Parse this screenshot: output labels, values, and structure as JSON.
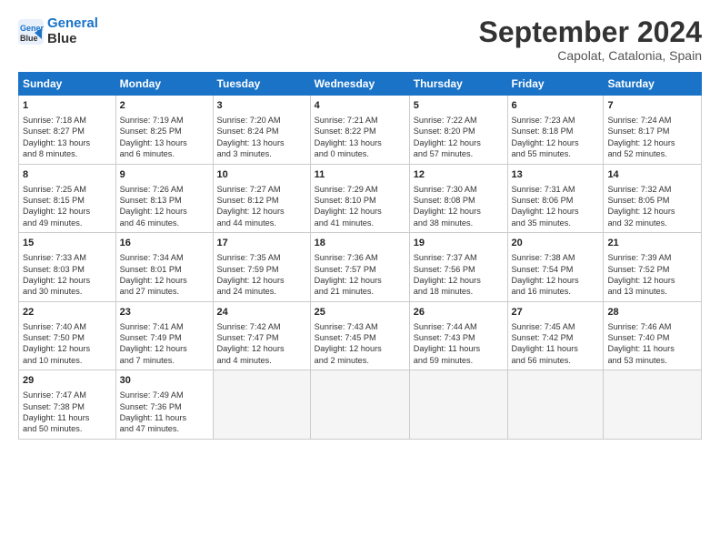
{
  "header": {
    "logo_line1": "General",
    "logo_line2": "Blue",
    "month_title": "September 2024",
    "location": "Capolat, Catalonia, Spain"
  },
  "calendar": {
    "days_of_week": [
      "Sunday",
      "Monday",
      "Tuesday",
      "Wednesday",
      "Thursday",
      "Friday",
      "Saturday"
    ],
    "weeks": [
      [
        {
          "day": "1",
          "info": "Sunrise: 7:18 AM\nSunset: 8:27 PM\nDaylight: 13 hours\nand 8 minutes."
        },
        {
          "day": "2",
          "info": "Sunrise: 7:19 AM\nSunset: 8:25 PM\nDaylight: 13 hours\nand 6 minutes."
        },
        {
          "day": "3",
          "info": "Sunrise: 7:20 AM\nSunset: 8:24 PM\nDaylight: 13 hours\nand 3 minutes."
        },
        {
          "day": "4",
          "info": "Sunrise: 7:21 AM\nSunset: 8:22 PM\nDaylight: 13 hours\nand 0 minutes."
        },
        {
          "day": "5",
          "info": "Sunrise: 7:22 AM\nSunset: 8:20 PM\nDaylight: 12 hours\nand 57 minutes."
        },
        {
          "day": "6",
          "info": "Sunrise: 7:23 AM\nSunset: 8:18 PM\nDaylight: 12 hours\nand 55 minutes."
        },
        {
          "day": "7",
          "info": "Sunrise: 7:24 AM\nSunset: 8:17 PM\nDaylight: 12 hours\nand 52 minutes."
        }
      ],
      [
        {
          "day": "8",
          "info": "Sunrise: 7:25 AM\nSunset: 8:15 PM\nDaylight: 12 hours\nand 49 minutes."
        },
        {
          "day": "9",
          "info": "Sunrise: 7:26 AM\nSunset: 8:13 PM\nDaylight: 12 hours\nand 46 minutes."
        },
        {
          "day": "10",
          "info": "Sunrise: 7:27 AM\nSunset: 8:12 PM\nDaylight: 12 hours\nand 44 minutes."
        },
        {
          "day": "11",
          "info": "Sunrise: 7:29 AM\nSunset: 8:10 PM\nDaylight: 12 hours\nand 41 minutes."
        },
        {
          "day": "12",
          "info": "Sunrise: 7:30 AM\nSunset: 8:08 PM\nDaylight: 12 hours\nand 38 minutes."
        },
        {
          "day": "13",
          "info": "Sunrise: 7:31 AM\nSunset: 8:06 PM\nDaylight: 12 hours\nand 35 minutes."
        },
        {
          "day": "14",
          "info": "Sunrise: 7:32 AM\nSunset: 8:05 PM\nDaylight: 12 hours\nand 32 minutes."
        }
      ],
      [
        {
          "day": "15",
          "info": "Sunrise: 7:33 AM\nSunset: 8:03 PM\nDaylight: 12 hours\nand 30 minutes."
        },
        {
          "day": "16",
          "info": "Sunrise: 7:34 AM\nSunset: 8:01 PM\nDaylight: 12 hours\nand 27 minutes."
        },
        {
          "day": "17",
          "info": "Sunrise: 7:35 AM\nSunset: 7:59 PM\nDaylight: 12 hours\nand 24 minutes."
        },
        {
          "day": "18",
          "info": "Sunrise: 7:36 AM\nSunset: 7:57 PM\nDaylight: 12 hours\nand 21 minutes."
        },
        {
          "day": "19",
          "info": "Sunrise: 7:37 AM\nSunset: 7:56 PM\nDaylight: 12 hours\nand 18 minutes."
        },
        {
          "day": "20",
          "info": "Sunrise: 7:38 AM\nSunset: 7:54 PM\nDaylight: 12 hours\nand 16 minutes."
        },
        {
          "day": "21",
          "info": "Sunrise: 7:39 AM\nSunset: 7:52 PM\nDaylight: 12 hours\nand 13 minutes."
        }
      ],
      [
        {
          "day": "22",
          "info": "Sunrise: 7:40 AM\nSunset: 7:50 PM\nDaylight: 12 hours\nand 10 minutes."
        },
        {
          "day": "23",
          "info": "Sunrise: 7:41 AM\nSunset: 7:49 PM\nDaylight: 12 hours\nand 7 minutes."
        },
        {
          "day": "24",
          "info": "Sunrise: 7:42 AM\nSunset: 7:47 PM\nDaylight: 12 hours\nand 4 minutes."
        },
        {
          "day": "25",
          "info": "Sunrise: 7:43 AM\nSunset: 7:45 PM\nDaylight: 12 hours\nand 2 minutes."
        },
        {
          "day": "26",
          "info": "Sunrise: 7:44 AM\nSunset: 7:43 PM\nDaylight: 11 hours\nand 59 minutes."
        },
        {
          "day": "27",
          "info": "Sunrise: 7:45 AM\nSunset: 7:42 PM\nDaylight: 11 hours\nand 56 minutes."
        },
        {
          "day": "28",
          "info": "Sunrise: 7:46 AM\nSunset: 7:40 PM\nDaylight: 11 hours\nand 53 minutes."
        }
      ],
      [
        {
          "day": "29",
          "info": "Sunrise: 7:47 AM\nSunset: 7:38 PM\nDaylight: 11 hours\nand 50 minutes."
        },
        {
          "day": "30",
          "info": "Sunrise: 7:49 AM\nSunset: 7:36 PM\nDaylight: 11 hours\nand 47 minutes."
        },
        {
          "day": "",
          "info": ""
        },
        {
          "day": "",
          "info": ""
        },
        {
          "day": "",
          "info": ""
        },
        {
          "day": "",
          "info": ""
        },
        {
          "day": "",
          "info": ""
        }
      ]
    ]
  }
}
